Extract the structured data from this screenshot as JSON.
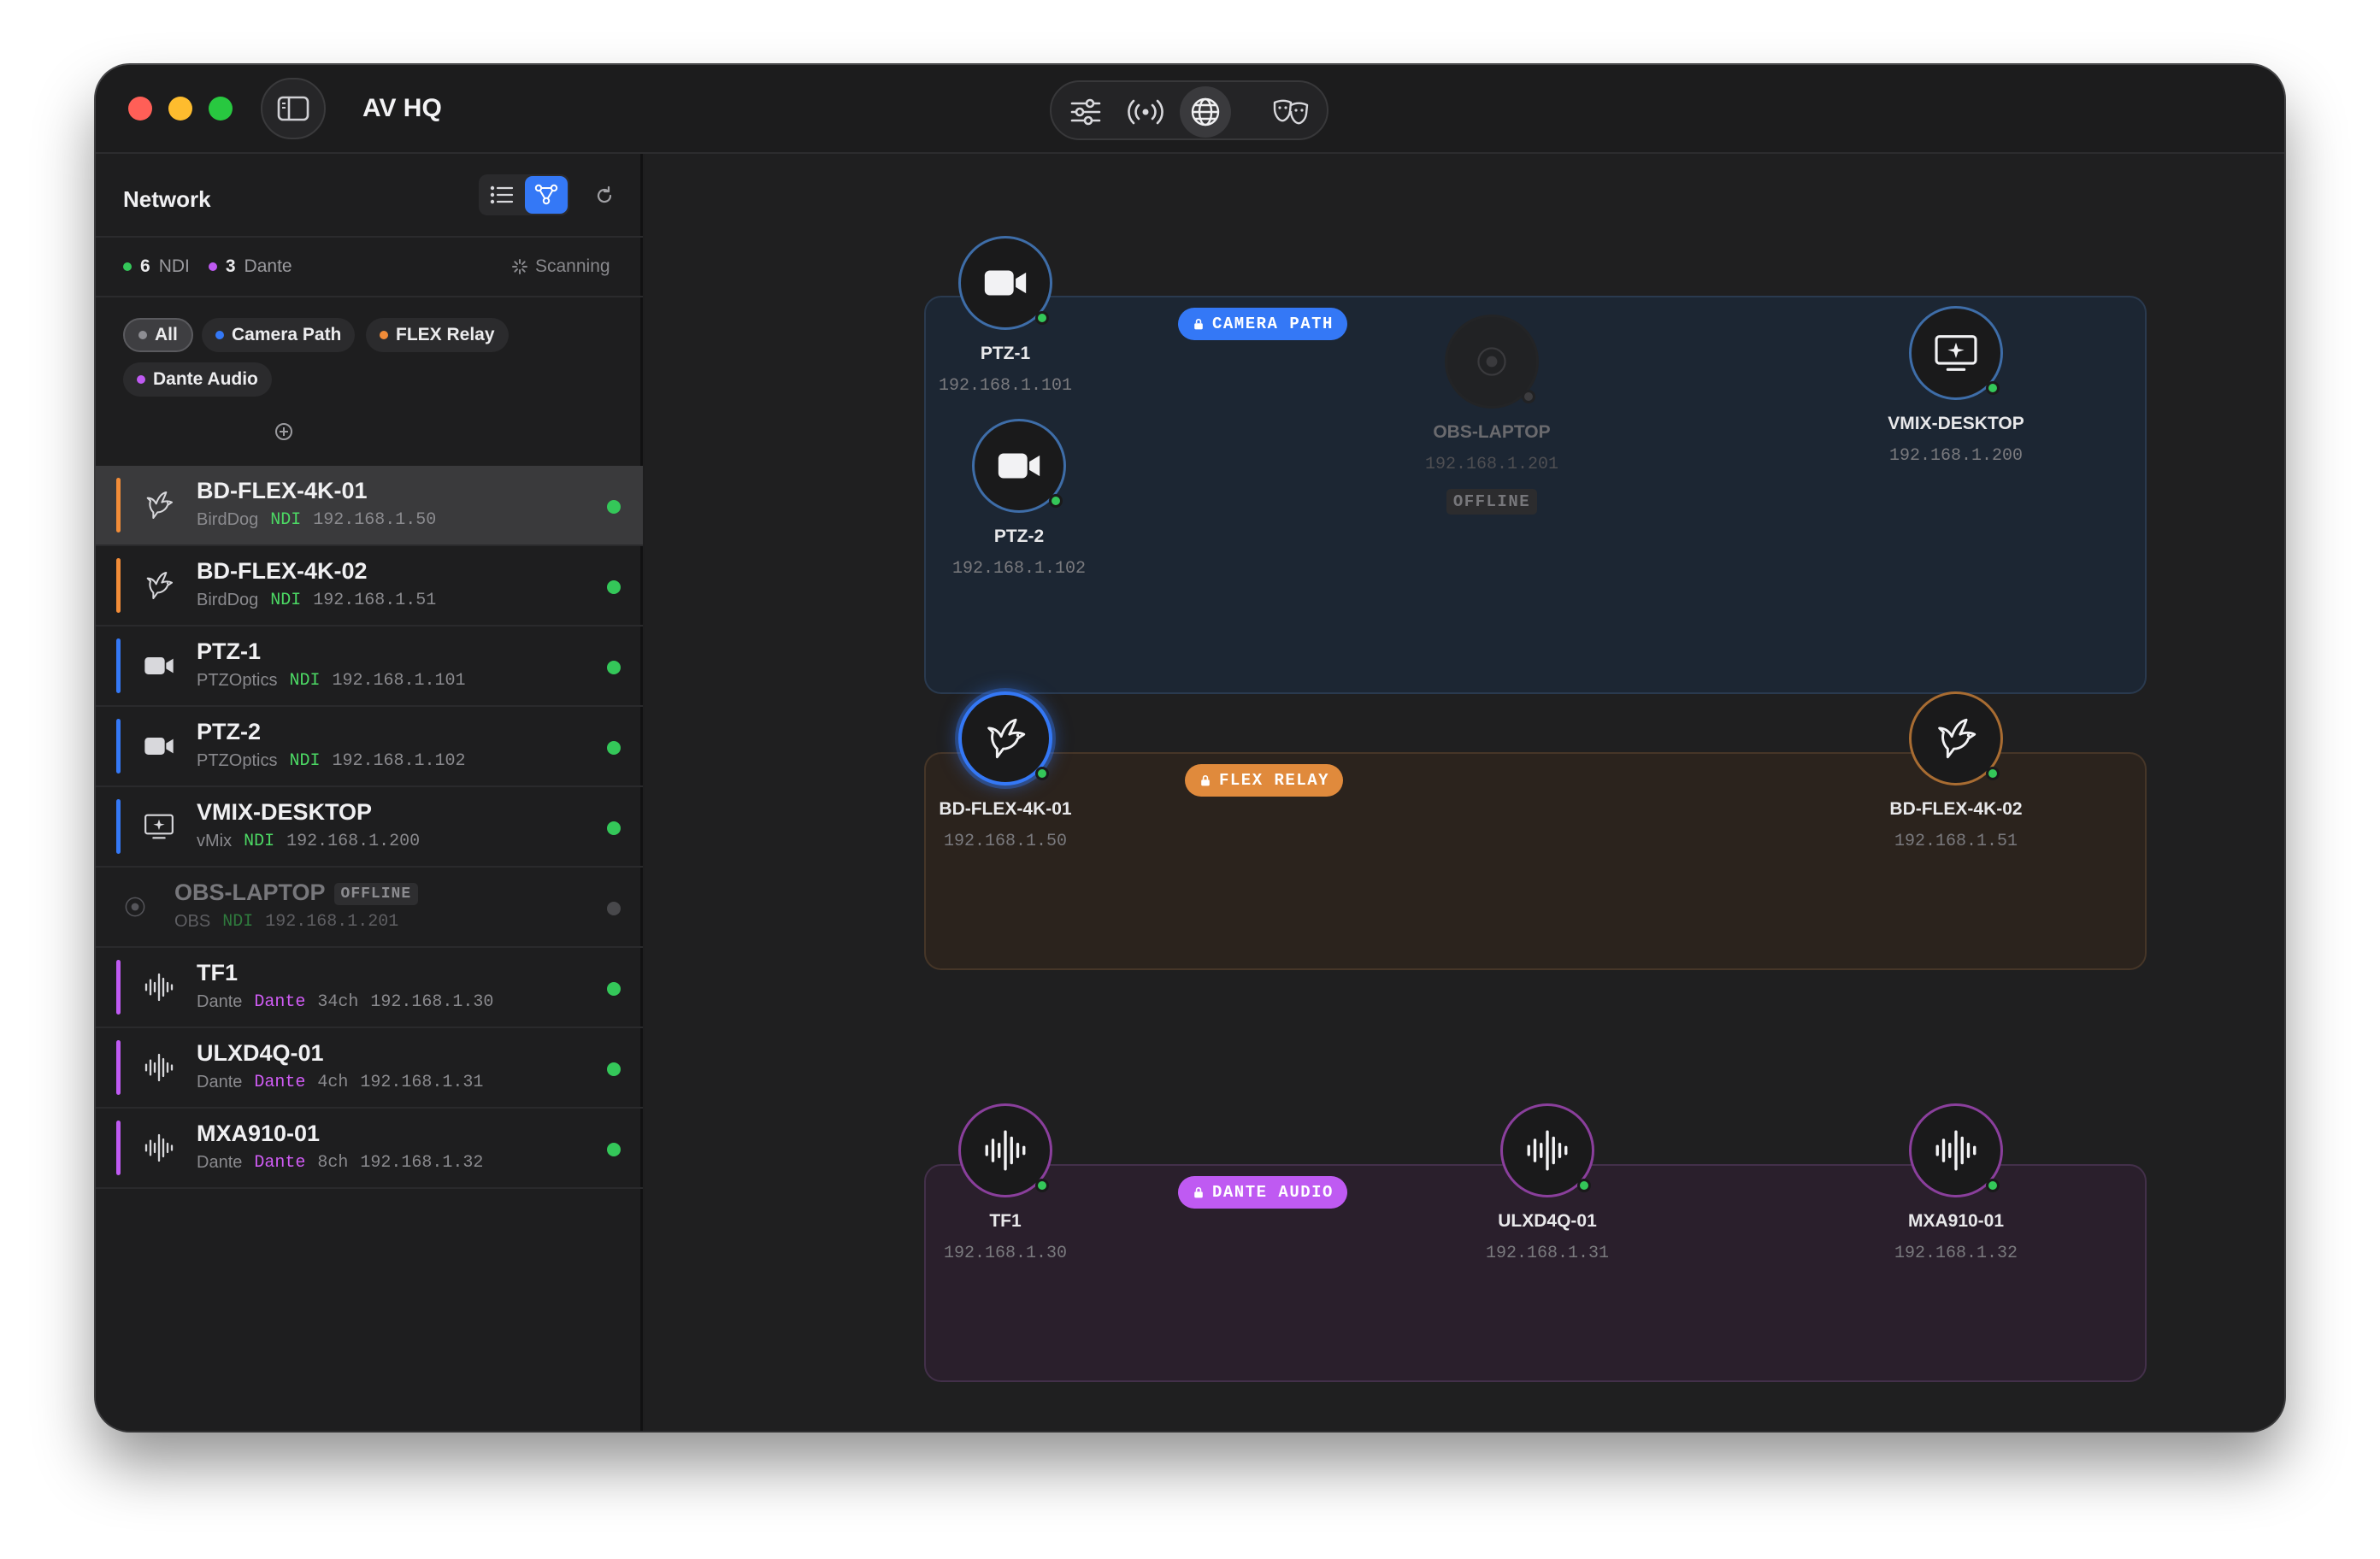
{
  "window": {
    "title": "AV HQ",
    "toolbar": [
      {
        "icon": "sliders-icon"
      },
      {
        "icon": "broadcast-icon"
      },
      {
        "icon": "globe-icon",
        "active": true
      },
      {
        "icon": "theater-masks-icon"
      }
    ]
  },
  "sidebar": {
    "title": "Network",
    "view_modes": [
      {
        "icon": "list-icon"
      },
      {
        "icon": "graph-icon",
        "active": true
      }
    ],
    "stats": {
      "ndi_count": "6",
      "ndi_label": "NDI",
      "dante_count": "3",
      "dante_label": "Dante",
      "scanning": "Scanning"
    },
    "filters": [
      {
        "label": "All",
        "color": "#8e8e93",
        "active": true
      },
      {
        "label": "Camera Path",
        "color": "#3478f6"
      },
      {
        "label": "FLEX Relay",
        "color": "#f28c38"
      },
      {
        "label": "Dante Audio",
        "color": "#bf5af2"
      }
    ],
    "devices": [
      {
        "name": "BD-FLEX-4K-01",
        "vendor": "BirdDog",
        "protocol": "NDI",
        "channels": "",
        "ip": "192.168.1.50",
        "icon": "bird-icon",
        "group_color": "#f28c38",
        "status": "online",
        "selected": true
      },
      {
        "name": "BD-FLEX-4K-02",
        "vendor": "BirdDog",
        "protocol": "NDI",
        "channels": "",
        "ip": "192.168.1.51",
        "icon": "bird-icon",
        "group_color": "#f28c38",
        "status": "online"
      },
      {
        "name": "PTZ-1",
        "vendor": "PTZOptics",
        "protocol": "NDI",
        "channels": "",
        "ip": "192.168.1.101",
        "icon": "video-camera-icon",
        "group_color": "#3478f6",
        "status": "online"
      },
      {
        "name": "PTZ-2",
        "vendor": "PTZOptics",
        "protocol": "NDI",
        "channels": "",
        "ip": "192.168.1.102",
        "icon": "video-camera-icon",
        "group_color": "#3478f6",
        "status": "online"
      },
      {
        "name": "VMIX-DESKTOP",
        "vendor": "vMix",
        "protocol": "NDI",
        "channels": "",
        "ip": "192.168.1.200",
        "icon": "display-sparkle-icon",
        "group_color": "#3478f6",
        "status": "online"
      },
      {
        "name": "OBS-LAPTOP",
        "vendor": "OBS",
        "protocol": "NDI",
        "channels": "",
        "ip": "192.168.1.201",
        "icon": "record-icon",
        "group_color": "",
        "status": "offline",
        "offline_label": "OFFLINE"
      },
      {
        "name": "TF1",
        "vendor": "Dante",
        "protocol": "Dante",
        "channels": "34ch",
        "ip": "192.168.1.30",
        "icon": "waveform-icon",
        "group_color": "#bf5af2",
        "status": "online"
      },
      {
        "name": "ULXD4Q-01",
        "vendor": "Dante",
        "protocol": "Dante",
        "channels": "4ch",
        "ip": "192.168.1.31",
        "icon": "waveform-icon",
        "group_color": "#bf5af2",
        "status": "online"
      },
      {
        "name": "MXA910-01",
        "vendor": "Dante",
        "protocol": "Dante",
        "channels": "8ch",
        "ip": "192.168.1.32",
        "icon": "waveform-icon",
        "group_color": "#bf5af2",
        "status": "online"
      }
    ]
  },
  "canvas": {
    "groups": [
      {
        "label": "CAMERA PATH",
        "color": "#3478f6",
        "lock_icon": "lock-icon",
        "nodes": [
          {
            "name": "PTZ-1",
            "ip": "192.168.1.101",
            "icon": "video-camera-icon",
            "status": "online"
          },
          {
            "name": "PTZ-2",
            "ip": "192.168.1.102",
            "icon": "video-camera-icon",
            "status": "online"
          },
          {
            "name": "OBS-LAPTOP",
            "ip": "192.168.1.201",
            "icon": "record-icon",
            "status": "offline",
            "offline_label": "OFFLINE"
          },
          {
            "name": "VMIX-DESKTOP",
            "ip": "192.168.1.200",
            "icon": "display-sparkle-icon",
            "status": "online"
          }
        ]
      },
      {
        "label": "FLEX RELAY",
        "color": "#e08a3c",
        "lock_icon": "lock-icon",
        "nodes": [
          {
            "name": "BD-FLEX-4K-01",
            "ip": "192.168.1.50",
            "icon": "bird-icon",
            "status": "online",
            "selected": true
          },
          {
            "name": "BD-FLEX-4K-02",
            "ip": "192.168.1.51",
            "icon": "bird-icon",
            "status": "online"
          }
        ]
      },
      {
        "label": "DANTE AUDIO",
        "color": "#bf5af2",
        "lock_icon": "lock-icon",
        "nodes": [
          {
            "name": "TF1",
            "ip": "192.168.1.30",
            "icon": "waveform-icon",
            "status": "online"
          },
          {
            "name": "ULXD4Q-01",
            "ip": "192.168.1.31",
            "icon": "waveform-icon",
            "status": "online"
          },
          {
            "name": "MXA910-01",
            "ip": "192.168.1.32",
            "icon": "waveform-icon",
            "status": "online"
          }
        ]
      }
    ]
  },
  "colors": {
    "online": "#34c759",
    "ndi": "#4cd964",
    "dante": "#d05cf5",
    "accent": "#3478f6"
  }
}
